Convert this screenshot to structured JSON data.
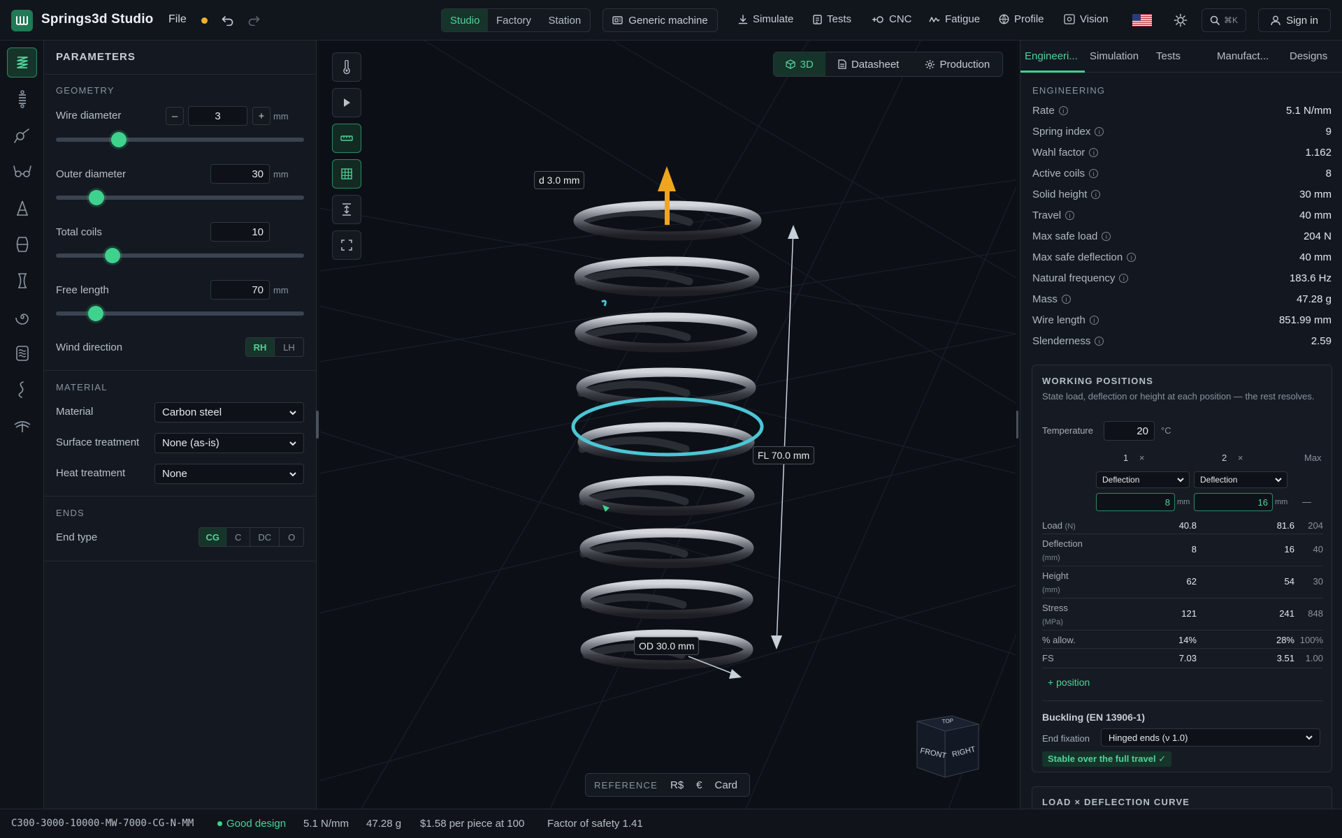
{
  "app": {
    "title": "Springs3d Studio",
    "file_menu": "File"
  },
  "modes": [
    {
      "label": "Studio"
    },
    {
      "label": "Factory"
    },
    {
      "label": "Station"
    }
  ],
  "machine": {
    "label": "Generic machine"
  },
  "nav": [
    {
      "label": "Simulate",
      "icon": "download-icon"
    },
    {
      "label": "Tests",
      "icon": "clipboard-icon"
    },
    {
      "label": "CNC",
      "icon": "cnc-icon"
    },
    {
      "label": "Fatigue",
      "icon": "wave-icon"
    },
    {
      "label": "Profile",
      "icon": "globe-icon"
    },
    {
      "label": "Vision",
      "icon": "eye-icon"
    }
  ],
  "search": {
    "shortcut": "⌘K"
  },
  "signin": {
    "label": "Sign in"
  },
  "params": {
    "title": "PARAMETERS",
    "geometry": {
      "heading": "GEOMETRY",
      "wire_diameter": {
        "label": "Wire diameter",
        "value": "3",
        "unit": "mm",
        "slider": 0.25
      },
      "outer_diameter": {
        "label": "Outer diameter",
        "value": "30",
        "unit": "mm",
        "slider": 0.16
      },
      "total_coils": {
        "label": "Total coils",
        "value": "10",
        "slider": 0.23
      },
      "free_length": {
        "label": "Free length",
        "value": "70",
        "unit": "mm",
        "slider": 0.16
      },
      "wind_direction": {
        "label": "Wind direction",
        "options": [
          "RH",
          "LH"
        ],
        "selected": "RH"
      }
    },
    "material": {
      "heading": "MATERIAL",
      "material": {
        "label": "Material",
        "value": "Carbon steel"
      },
      "surface": {
        "label": "Surface treatment",
        "value": "None (as-is)"
      },
      "heat": {
        "label": "Heat treatment",
        "value": "None"
      }
    },
    "ends": {
      "heading": "ENDS",
      "end_type": {
        "label": "End type",
        "options": [
          "CG",
          "C",
          "DC",
          "O"
        ],
        "selected": "CG"
      }
    }
  },
  "viewport": {
    "view_tabs": [
      {
        "label": "3D"
      },
      {
        "label": "Datasheet"
      },
      {
        "label": "Production"
      }
    ],
    "dims": {
      "wire": "d 3.0 mm",
      "free_length": "FL 70.0 mm",
      "outer": "OD 30.0 mm"
    },
    "view_cube": {
      "front": "FRONT",
      "right": "RIGHT",
      "top": "TOP"
    },
    "reference": {
      "label": "REFERENCE",
      "options": [
        "R$",
        "€",
        "Card"
      ]
    }
  },
  "right": {
    "tabs": [
      "Engineeri...",
      "Simulation",
      "Tests",
      "Manufact...",
      "Designs"
    ],
    "engineering": {
      "heading": "ENGINEERING",
      "rows": [
        {
          "k": "Rate",
          "v": "5.1 N/mm"
        },
        {
          "k": "Spring index",
          "v": "9"
        },
        {
          "k": "Wahl factor",
          "v": "1.162"
        },
        {
          "k": "Active coils",
          "v": "8"
        },
        {
          "k": "Solid height",
          "v": "30 mm"
        },
        {
          "k": "Travel",
          "v": "40 mm"
        },
        {
          "k": "Max safe load",
          "v": "204 N"
        },
        {
          "k": "Max safe deflection",
          "v": "40 mm"
        },
        {
          "k": "Natural frequency",
          "v": "183.6 Hz"
        },
        {
          "k": "Mass",
          "v": "47.28 g"
        },
        {
          "k": "Wire length",
          "v": "851.99 mm"
        },
        {
          "k": "Slenderness",
          "v": "2.59"
        }
      ]
    },
    "working": {
      "title": "WORKING POSITIONS",
      "subtitle": "State load, deflection or height at each position — the rest resolves.",
      "temperature": {
        "label": "Temperature",
        "value": "20",
        "unit": "°C"
      },
      "col1": "1",
      "col2": "2",
      "col_max": "Max",
      "remove": "×",
      "mode1": "Deflection",
      "mode2": "Deflection",
      "input1": "8",
      "input2": "16",
      "unit": "mm",
      "max_dash": "—",
      "rows": [
        {
          "label": "Load",
          "unit": "(N)",
          "v1": "40.8",
          "v2": "81.6",
          "max": "204"
        },
        {
          "label": "Deflection",
          "unit": "(mm)",
          "v1": "8",
          "v2": "16",
          "max": "40"
        },
        {
          "label": "Height",
          "unit": "(mm)",
          "v1": "62",
          "v2": "54",
          "max": "30"
        },
        {
          "label": "Stress",
          "unit": "(MPa)",
          "v1": "121",
          "v2": "241",
          "max": "848"
        },
        {
          "label": "% allow.",
          "unit": "",
          "v1": "14%",
          "v2": "28%",
          "max": "100%"
        },
        {
          "label": "FS",
          "unit": "",
          "v1": "7.03",
          "v2": "3.51",
          "max": "1.00"
        }
      ],
      "add_position": "+ position",
      "buckling_title": "Buckling (EN 13906-1)",
      "end_fixation_label": "End fixation",
      "end_fixation_value": "Hinged ends (ν 1.0)",
      "stable": "Stable over the full travel ✓"
    },
    "curve_title": "LOAD × DEFLECTION CURVE"
  },
  "status": {
    "code": "C300-3000-10000-MW-7000-CG-N-MM",
    "verdict": "Good design",
    "rate": "5.1 N/mm",
    "mass": "47.28 g",
    "price": "$1.58 per piece at 100",
    "fos": "Factor of safety 1.41"
  },
  "colors": {
    "accent": "#3ed28d",
    "unsaved": "#f0b02b",
    "arrow": "#f0a51f",
    "ring": "#4cc6d6"
  }
}
